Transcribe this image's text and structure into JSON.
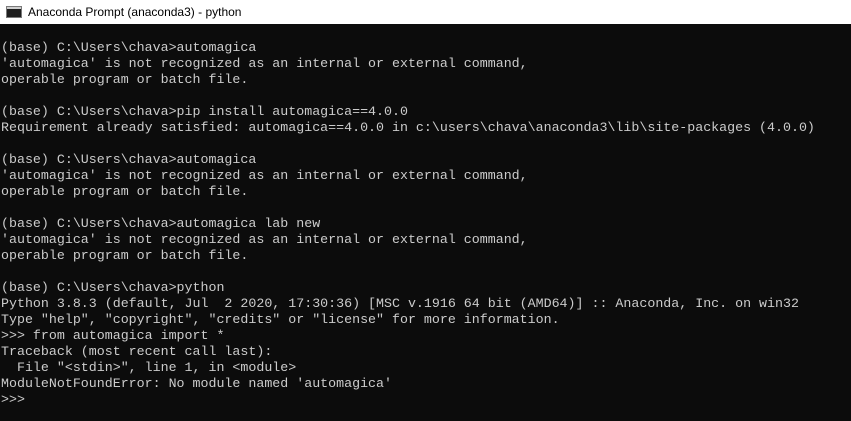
{
  "window": {
    "title": "Anaconda Prompt (anaconda3) - python",
    "icon": "console-icon"
  },
  "colors": {
    "background": "#0c0c0c",
    "text": "#cccccc",
    "titlebar": "#ffffff"
  },
  "console": {
    "lines": [
      "(base) C:\\Users\\chava>automagica",
      "'automagica' is not recognized as an internal or external command,",
      "operable program or batch file.",
      "",
      "(base) C:\\Users\\chava>pip install automagica==4.0.0",
      "Requirement already satisfied: automagica==4.0.0 in c:\\users\\chava\\anaconda3\\lib\\site-packages (4.0.0)",
      "",
      "(base) C:\\Users\\chava>automagica",
      "'automagica' is not recognized as an internal or external command,",
      "operable program or batch file.",
      "",
      "(base) C:\\Users\\chava>automagica lab new",
      "'automagica' is not recognized as an internal or external command,",
      "operable program or batch file.",
      "",
      "(base) C:\\Users\\chava>python",
      "Python 3.8.3 (default, Jul  2 2020, 17:30:36) [MSC v.1916 64 bit (AMD64)] :: Anaconda, Inc. on win32",
      "Type \"help\", \"copyright\", \"credits\" or \"license\" for more information.",
      ">>> from automagica import *",
      "Traceback (most recent call last):",
      "  File \"<stdin>\", line 1, in <module>",
      "ModuleNotFoundError: No module named 'automagica'",
      ">>>"
    ]
  }
}
